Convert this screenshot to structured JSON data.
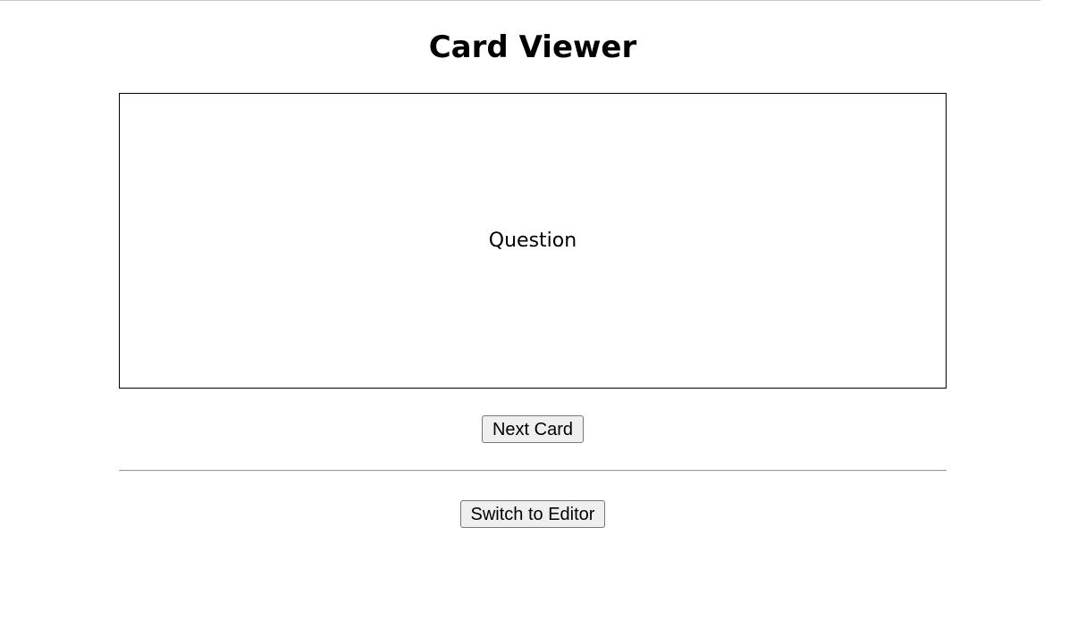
{
  "header": {
    "title": "Card Viewer"
  },
  "card": {
    "text": "Question"
  },
  "controls": {
    "next_label": "Next Card",
    "switch_label": "Switch to Editor"
  },
  "colors": {
    "background": "#ffffff",
    "card_border": "#000000",
    "button_bg": "#efefef",
    "button_border": "#767676"
  }
}
